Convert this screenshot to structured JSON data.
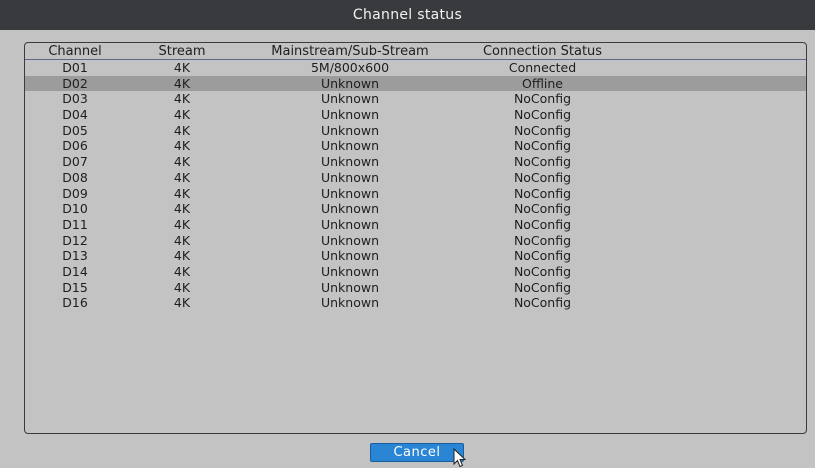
{
  "dialog": {
    "title": "Channel status"
  },
  "table": {
    "headers": {
      "channel": "Channel",
      "stream": "Stream",
      "mainstream": "Mainstream/Sub-Stream",
      "connection": "Connection Status"
    },
    "selected_row": 1,
    "rows": [
      {
        "channel": "D01",
        "stream": "4K",
        "mainstream": "5M/800x600",
        "connection": "Connected"
      },
      {
        "channel": "D02",
        "stream": "4K",
        "mainstream": "Unknown",
        "connection": "Offline"
      },
      {
        "channel": "D03",
        "stream": "4K",
        "mainstream": "Unknown",
        "connection": "NoConfig"
      },
      {
        "channel": "D04",
        "stream": "4K",
        "mainstream": "Unknown",
        "connection": "NoConfig"
      },
      {
        "channel": "D05",
        "stream": "4K",
        "mainstream": "Unknown",
        "connection": "NoConfig"
      },
      {
        "channel": "D06",
        "stream": "4K",
        "mainstream": "Unknown",
        "connection": "NoConfig"
      },
      {
        "channel": "D07",
        "stream": "4K",
        "mainstream": "Unknown",
        "connection": "NoConfig"
      },
      {
        "channel": "D08",
        "stream": "4K",
        "mainstream": "Unknown",
        "connection": "NoConfig"
      },
      {
        "channel": "D09",
        "stream": "4K",
        "mainstream": "Unknown",
        "connection": "NoConfig"
      },
      {
        "channel": "D10",
        "stream": "4K",
        "mainstream": "Unknown",
        "connection": "NoConfig"
      },
      {
        "channel": "D11",
        "stream": "4K",
        "mainstream": "Unknown",
        "connection": "NoConfig"
      },
      {
        "channel": "D12",
        "stream": "4K",
        "mainstream": "Unknown",
        "connection": "NoConfig"
      },
      {
        "channel": "D13",
        "stream": "4K",
        "mainstream": "Unknown",
        "connection": "NoConfig"
      },
      {
        "channel": "D14",
        "stream": "4K",
        "mainstream": "Unknown",
        "connection": "NoConfig"
      },
      {
        "channel": "D15",
        "stream": "4K",
        "mainstream": "Unknown",
        "connection": "NoConfig"
      },
      {
        "channel": "D16",
        "stream": "4K",
        "mainstream": "Unknown",
        "connection": "NoConfig"
      }
    ]
  },
  "buttons": {
    "cancel_label": "Cancel"
  },
  "icons": {
    "cursor": "mouse-pointer-icon"
  },
  "colors": {
    "title_bar": "#393a3d",
    "background": "#c2c3c2",
    "selected_row": "#9c9c9c",
    "button": "#2a86d4"
  }
}
